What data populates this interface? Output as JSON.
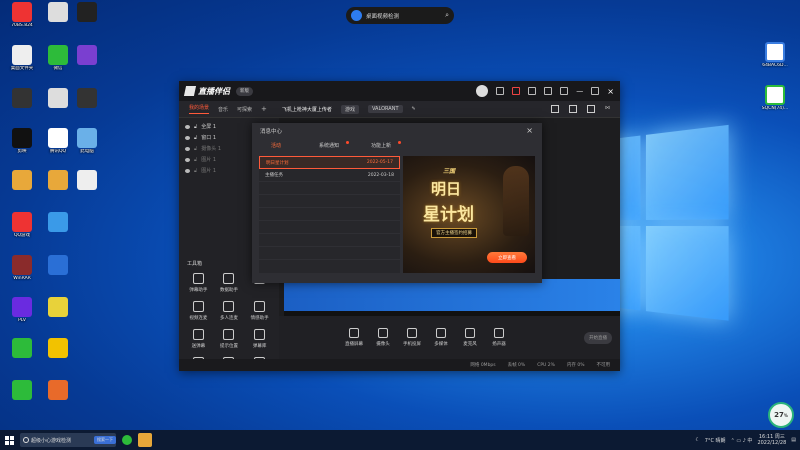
{
  "desktop": {
    "search_pill": "桌面视频检测",
    "left_icons": [
      {
        "label": "70BS.824",
        "color": "#e33"
      },
      {
        "label": "",
        "color": "#ddd"
      },
      {
        "label": "",
        "color": "#222"
      },
      {
        "label": "桌面文件夹",
        "color": "#eee"
      },
      {
        "label": "微信",
        "color": "#2dbb3a"
      },
      {
        "label": "",
        "color": "#7a3fd0"
      },
      {
        "label": "",
        "color": "#333"
      },
      {
        "label": "",
        "color": "#ddd"
      },
      {
        "label": "",
        "color": "#333"
      },
      {
        "label": "剪映",
        "color": "#111"
      },
      {
        "label": "腾讯QQ",
        "color": "#fff"
      },
      {
        "label": "此电脑",
        "color": "#6ab0e8"
      },
      {
        "label": "",
        "color": "#e8a83a"
      },
      {
        "label": "",
        "color": "#e8a83a"
      },
      {
        "label": "",
        "color": "#eee"
      },
      {
        "label": "QQ游戏",
        "color": "#e33"
      },
      {
        "label": "",
        "color": "#3a9ae8"
      },
      {
        "label": "WinRAR",
        "color": "#8a2b2b"
      },
      {
        "label": "",
        "color": "#2a6fd6"
      },
      {
        "label": "PLV",
        "color": "#6a2be0"
      },
      {
        "label": "",
        "color": "#e8d23a"
      },
      {
        "label": "",
        "color": "#2dbb3a"
      },
      {
        "label": "",
        "color": "#f2c200"
      },
      {
        "label": "",
        "color": "#2dbb3a"
      },
      {
        "label": "",
        "color": "#e86a2a"
      }
    ],
    "right_icons": [
      {
        "label": "64BAC6D...",
        "color": "#3a7de0"
      },
      {
        "label": "SQCN(74)...",
        "color": "#2dbb3a"
      }
    ]
  },
  "app": {
    "brand": "直播伴侣",
    "version": "新版",
    "tabs": [
      "我的场景",
      "音乐",
      "可探索"
    ],
    "game": "飞机上枪神大厦上传者",
    "chip1": "游戏",
    "chip2": "VALORANT",
    "scenes": [
      {
        "label": "全屏 1",
        "dim": false
      },
      {
        "label": "窗口 1",
        "dim": false
      },
      {
        "label": "摄像头 1",
        "dim": true
      },
      {
        "label": "图片 1",
        "dim": true
      },
      {
        "label": "图片 1",
        "dim": true
      }
    ],
    "toolbox_title": "工具箱",
    "tools": [
      "弹幕助手",
      "数据助手",
      "",
      "视频连麦",
      "多人连麦",
      "情感助手",
      "送弹幕",
      "提示位置",
      "弹幕库",
      "",
      "",
      ""
    ],
    "notice": "1 条直播伴侣使用前提醒",
    "controls": [
      "直播屏幕",
      "摄像头",
      "手机投屏",
      "多媒体",
      "麦克风",
      "扬声器"
    ],
    "start_label": "开始直播",
    "status": [
      "网络 0Mbps",
      "丢帧 0%",
      "CPU 2%",
      "内存 0%",
      "不可用"
    ]
  },
  "modal": {
    "title": "消息中心",
    "close": "×",
    "tabs": [
      "活动",
      "系统通知",
      "功能上新"
    ],
    "rows": [
      {
        "name": "明日星计划",
        "date": "2022-05-17",
        "active": true
      },
      {
        "name": "主播任务",
        "date": "2022-03-18",
        "active": false
      }
    ],
    "promo": {
      "head": "三国",
      "line1": "明日",
      "line2": "星计划",
      "sub": "官方主播签约招募",
      "cta": "立即查看"
    }
  },
  "taskbar": {
    "search": "超级小心游戏检测",
    "search_hint": "搜索一下",
    "weather": "7°C 晴朗",
    "time": "16:11 周三",
    "date": "2022/12/28",
    "gauge_value": "27",
    "gauge_unit": "%"
  }
}
